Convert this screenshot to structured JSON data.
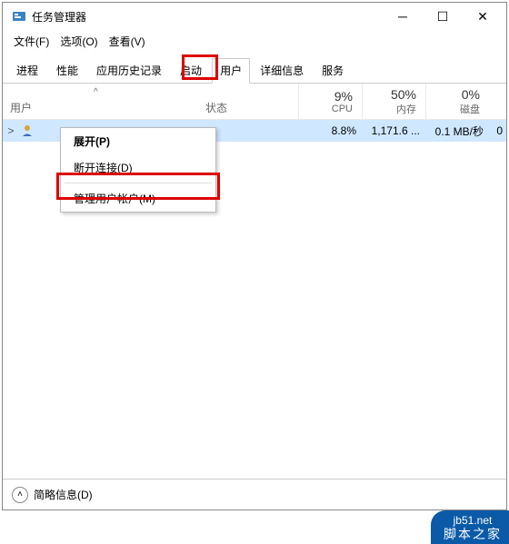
{
  "window": {
    "title": "任务管理器"
  },
  "menu": {
    "file": "文件(F)",
    "options": "选项(O)",
    "view": "查看(V)"
  },
  "tabs": {
    "processes": "进程",
    "performance": "性能",
    "history": "应用历史记录",
    "startup": "启动",
    "users": "用户",
    "details": "详细信息",
    "services": "服务"
  },
  "columns": {
    "user": "用户",
    "status": "状态",
    "cpu_pct": "9%",
    "cpu_lbl": "CPU",
    "mem_pct": "50%",
    "mem_lbl": "内存",
    "disk_pct": "0%",
    "disk_lbl": "磁盘",
    "sort_glyph": "^"
  },
  "row": {
    "expand": ">",
    "cpu": "8.8%",
    "mem": "1,171.6 ...",
    "disk": "0.1 MB/秒",
    "extra": "0"
  },
  "context": {
    "expand": "展开(P)",
    "disconnect": "断开连接(D)",
    "manage": "管理用户帐户(M)"
  },
  "statusbar": {
    "fewer": "简略信息(D)"
  },
  "watermark": {
    "url": "jb51.net",
    "name": "脚本之家"
  }
}
